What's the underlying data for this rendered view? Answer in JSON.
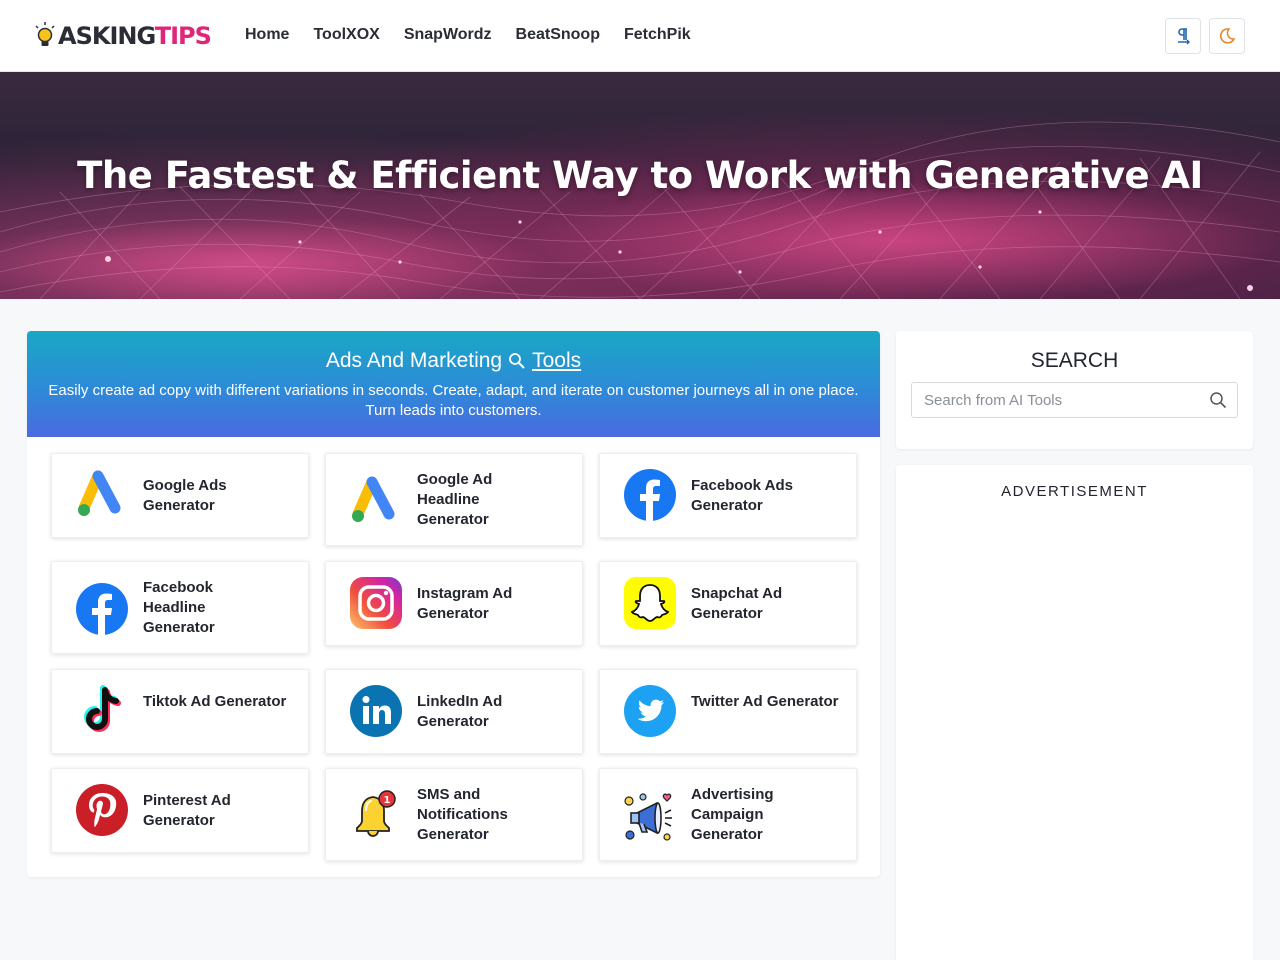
{
  "brand": {
    "part1": "ASKING",
    "part2": "TIPS"
  },
  "nav": [
    "Home",
    "ToolXOX",
    "SnapWordz",
    "BeatSnoop",
    "FetchPik"
  ],
  "header_buttons": [
    "paragraph-icon",
    "moon-icon"
  ],
  "hero": {
    "title": "The Fastest & Efficient Way to Work with Generative AI"
  },
  "section": {
    "title_part1": "Ads And Marketing",
    "title_part2": "Tools",
    "description": "Easily create ad copy with different variations in seconds. Create, adapt, and iterate on customer journeys all in one place. Turn leads into customers."
  },
  "tools": [
    {
      "label": "Google Ads Generator",
      "icon": "google-ads-icon"
    },
    {
      "label": "Google Ad Headline Generator",
      "icon": "google-ads-icon"
    },
    {
      "label": "Facebook Ads Generator",
      "icon": "facebook-icon"
    },
    {
      "label": "Facebook Headline Generator",
      "icon": "facebook-icon"
    },
    {
      "label": "Instagram Ad Generator",
      "icon": "instagram-icon"
    },
    {
      "label": "Snapchat Ad Generator",
      "icon": "snapchat-icon"
    },
    {
      "label": "Tiktok Ad Generator",
      "icon": "tiktok-icon"
    },
    {
      "label": "LinkedIn Ad Generator",
      "icon": "linkedin-icon"
    },
    {
      "label": "Twitter Ad Generator",
      "icon": "twitter-icon"
    },
    {
      "label": "Pinterest Ad Generator",
      "icon": "pinterest-icon"
    },
    {
      "label": "SMS and Notifications Generator",
      "icon": "notification-bell-icon"
    },
    {
      "label": "Advertising Campaign Generator",
      "icon": "megaphone-icon"
    }
  ],
  "sidebar": {
    "search_title": "SEARCH",
    "search_placeholder": "Search from AI Tools",
    "ad_label": "ADVERTISEMENT"
  },
  "colors": {
    "brand_accent": "#e0267a",
    "header_gradient_top": "#1aa8c4",
    "header_gradient_bottom": "#4b6ae0"
  }
}
